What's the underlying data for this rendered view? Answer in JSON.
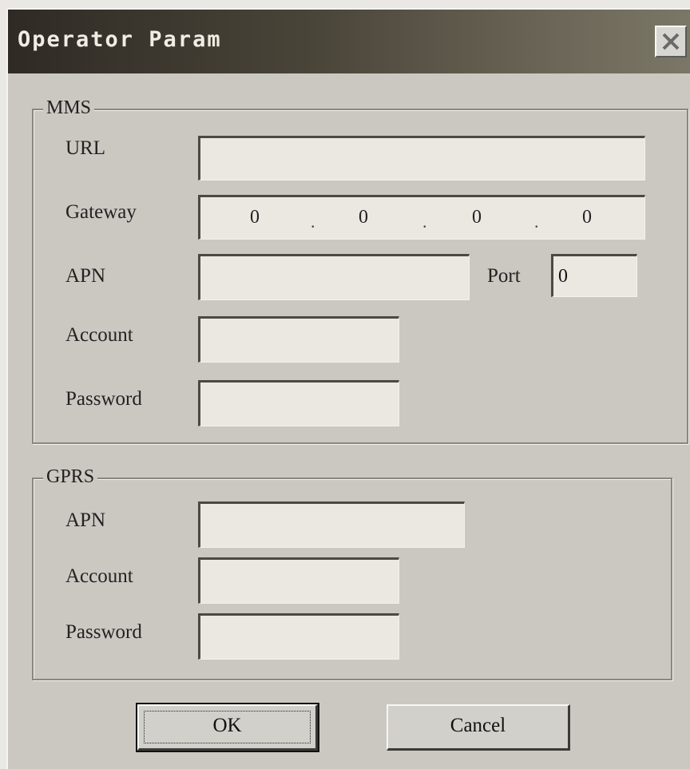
{
  "window": {
    "title": "Operator Param",
    "close_icon": "close-icon"
  },
  "mms": {
    "legend": "MMS",
    "url_label": "URL",
    "url_value": "",
    "gateway_label": "Gateway",
    "gateway_octets": [
      "0",
      "0",
      "0",
      "0"
    ],
    "apn_label": "APN",
    "apn_value": "",
    "port_label": "Port",
    "port_value": "0",
    "account_label": "Account",
    "account_value": "",
    "password_label": "Password",
    "password_value": ""
  },
  "gprs": {
    "legend": "GPRS",
    "apn_label": "APN",
    "apn_value": "",
    "account_label": "Account",
    "account_value": "",
    "password_label": "Password",
    "password_value": ""
  },
  "buttons": {
    "ok": "OK",
    "cancel": "Cancel"
  }
}
